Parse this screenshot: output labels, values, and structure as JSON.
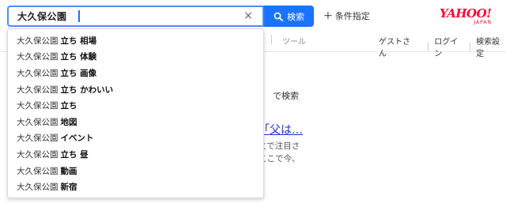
{
  "search": {
    "query": "大久保公園",
    "clear_label": "×",
    "button_label": "検索",
    "conditions_label": "条件指定",
    "conditions_plus": "+"
  },
  "logo": {
    "main": "YAHOO!",
    "sub": "JAPAN"
  },
  "header": {
    "tool_label": "ツール",
    "guest_label": "ゲストさん",
    "login_label": "ログイン",
    "settings_label": "検索設定"
  },
  "background": {
    "search_hint": "で検索",
    "result_link": "「父は…",
    "snippet_line1": "とで注目さ",
    "snippet_line2": "ここで今、"
  },
  "suggestions": [
    {
      "base": "大久保公園",
      "extra": "立ち 相場"
    },
    {
      "base": "大久保公園",
      "extra": "立ち 体験"
    },
    {
      "base": "大久保公園",
      "extra": "立ち 画像"
    },
    {
      "base": "大久保公園",
      "extra": "立ち かわいい"
    },
    {
      "base": "大久保公園",
      "extra": "立ち"
    },
    {
      "base": "大久保公園",
      "extra": "地図"
    },
    {
      "base": "大久保公園",
      "extra": "イベント"
    },
    {
      "base": "大久保公園",
      "extra": "立ち 昼"
    },
    {
      "base": "大久保公園",
      "extra": "動画"
    },
    {
      "base": "大久保公園",
      "extra": "新宿"
    }
  ],
  "colors": {
    "accent": "#1a73ff",
    "logo": "#ff0033",
    "link": "#1f2fd0"
  }
}
